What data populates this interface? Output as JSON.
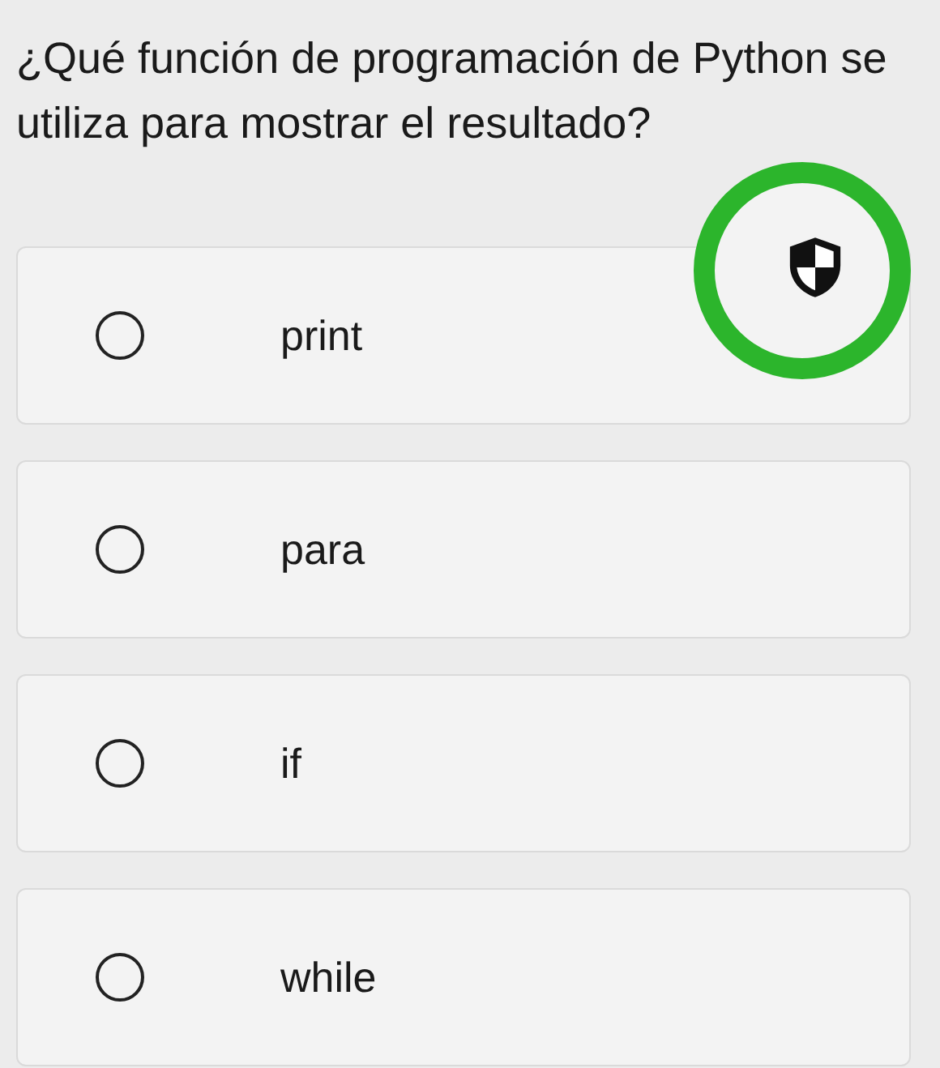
{
  "question": "¿Qué función de programación de Python se utiliza para mostrar el resultado?",
  "options": [
    {
      "label": "print",
      "selected": false
    },
    {
      "label": "para",
      "selected": false
    },
    {
      "label": "if",
      "selected": false
    },
    {
      "label": "while",
      "selected": false
    }
  ]
}
